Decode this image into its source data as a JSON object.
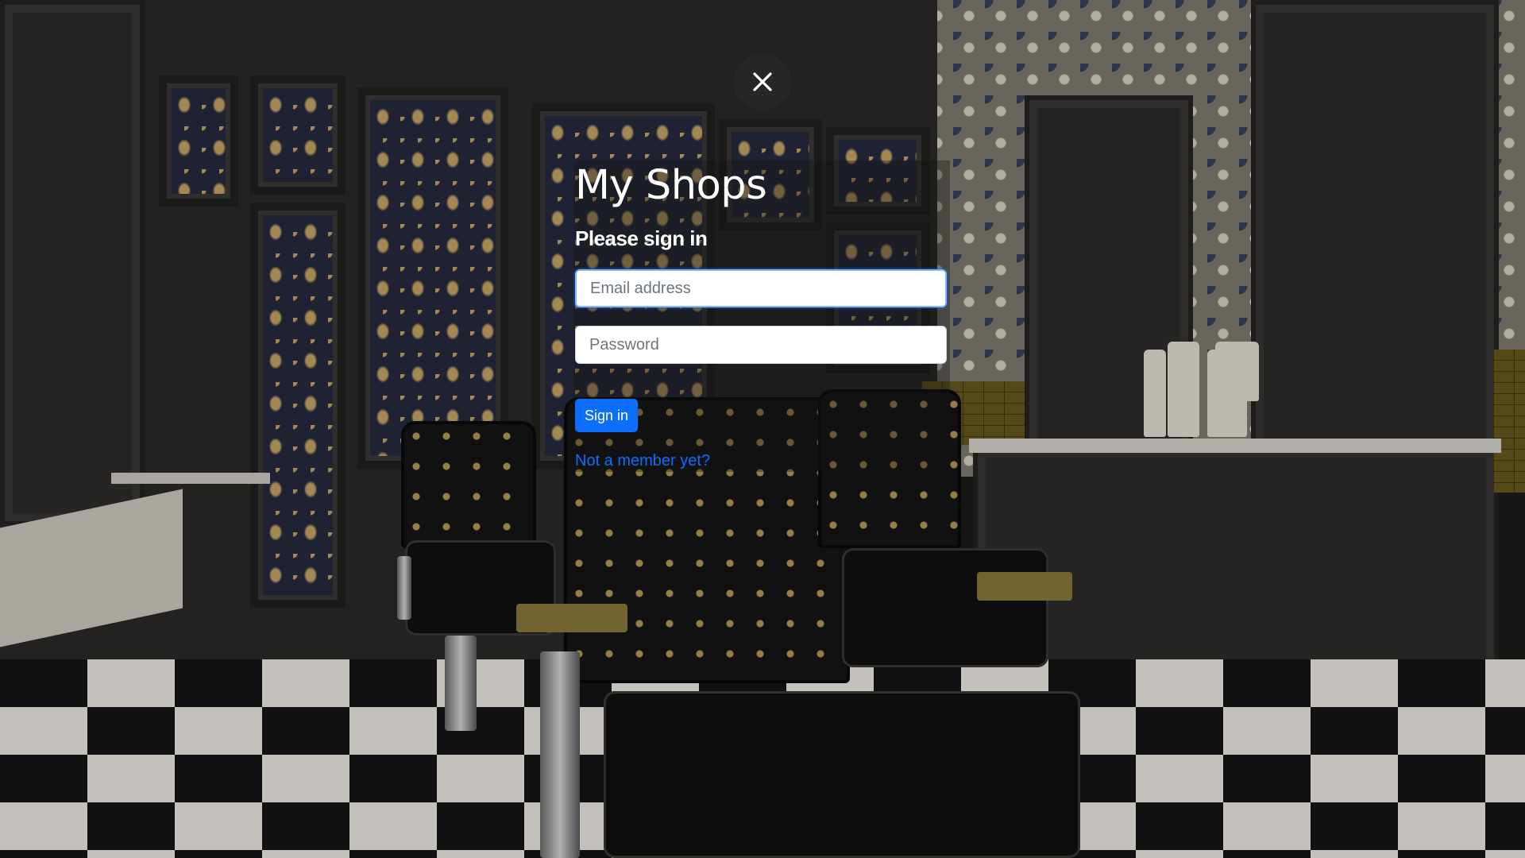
{
  "modal": {
    "close_icon": "close-icon"
  },
  "signin": {
    "title": "My Shops",
    "subtitle": "Please sign in",
    "email_placeholder": "Email address",
    "email_value": "",
    "password_placeholder": "Password",
    "password_value": "",
    "submit_label": "Sign in",
    "signup_link": "Not a member yet?"
  },
  "background": {
    "description_icon": "barbershop-photo"
  },
  "colors": {
    "primary": "#0d6efd",
    "title_text": "#ffffff",
    "close_button_bg": "#2a2a2a"
  }
}
